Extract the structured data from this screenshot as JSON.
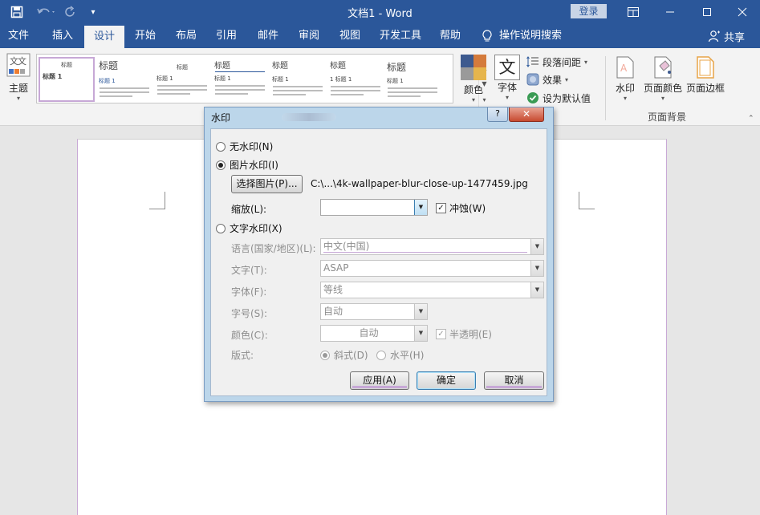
{
  "app": {
    "title": "文档1 - Word",
    "login": "登录"
  },
  "colors": {
    "accent": "#2b579a",
    "dialog_frame": "#bcd6ea"
  },
  "quick_access": {
    "save_icon": "save-icon",
    "undo_icon": "undo-icon",
    "redo_icon": "redo-icon",
    "customize_icon": "customize-icon"
  },
  "tabs": [
    "文件",
    "插入",
    "设计",
    "开始",
    "布局",
    "引用",
    "邮件",
    "审阅",
    "视图",
    "开发工具",
    "帮助"
  ],
  "active_tab": "设计",
  "tell_me": "操作说明搜索",
  "share": "共享",
  "ribbon": {
    "theme": "主题",
    "styles": [
      {
        "title": "标题",
        "heading": "标题 1"
      },
      {
        "title": "标题",
        "heading": "标题 1"
      },
      {
        "title": "标题",
        "heading": "标题 1"
      },
      {
        "title": "标题",
        "heading": "标题 1"
      },
      {
        "title": "标题",
        "heading": "标题 1"
      },
      {
        "title": "标题",
        "heading": "1 标题 1"
      },
      {
        "title": "标题",
        "heading": "标题 1"
      }
    ],
    "colors": "颜色",
    "fonts": "字体",
    "fonts_glyph": "文",
    "paragraph_spacing": "段落间距",
    "effects": "效果",
    "set_default": "设为默认值",
    "watermark": "水印",
    "page_color": "页面颜色",
    "page_borders": "页面边框",
    "page_background_group": "页面背景"
  },
  "dialog": {
    "title": "水印",
    "help": "?",
    "close": "✕",
    "no_watermark": "无水印(N)",
    "picture_watermark": "图片水印(I)",
    "select_picture": "选择图片(P)...",
    "picture_path": "C:\\...\\4k-wallpaper-blur-close-up-1477459.jpg",
    "scale_label": "缩放(L):",
    "scale_value": "",
    "washout": "冲蚀(W)",
    "washout_checked": true,
    "text_watermark": "文字水印(X)",
    "language_label": "语言(国家/地区)(L):",
    "language_value": "中文(中国)",
    "text_label": "文字(T):",
    "text_value": "ASAP",
    "font_label": "字体(F):",
    "font_value": "等线",
    "size_label": "字号(S):",
    "size_value": "自动",
    "color_label": "颜色(C):",
    "color_value": "自动",
    "semitransparent": "半透明(E)",
    "semitransparent_checked": true,
    "layout_label": "版式:",
    "diagonal": "斜式(D)",
    "horizontal": "水平(H)",
    "apply": "应用(A)",
    "ok": "确定",
    "cancel": "取消"
  }
}
